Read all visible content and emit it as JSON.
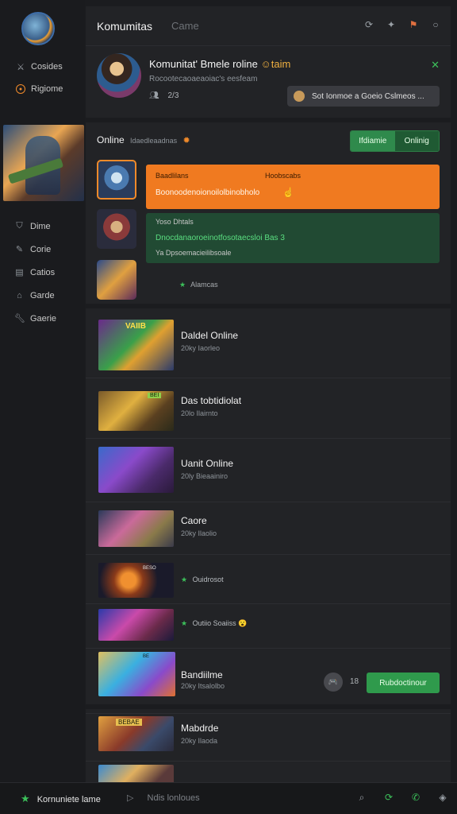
{
  "sidebar": {
    "nav": [
      {
        "label": "Cosides",
        "icon": "swords-icon"
      },
      {
        "label": "Rigiome",
        "icon": "target-icon"
      }
    ],
    "menu": [
      {
        "label": "Dime",
        "icon": "shield-icon"
      },
      {
        "label": "Corie",
        "icon": "edit-icon"
      },
      {
        "label": "Catios",
        "icon": "card-icon"
      },
      {
        "label": "Garde",
        "icon": "house-icon"
      },
      {
        "label": "Gaerie",
        "icon": "wrench-icon"
      }
    ]
  },
  "header": {
    "title": "Komumitas",
    "subtitle": "Came"
  },
  "profile": {
    "name": "Komunitat' Bmele roline",
    "name_suffix": "☺taim",
    "subtitle": "Rocootecaoaeaoiac's eesfeam",
    "member_count": "2/3",
    "action_label": "Sot Ionmoe a Goeio Cslmeos ..."
  },
  "online": {
    "title": "Online",
    "subtitle": "Idaedleaadnas",
    "toggle": [
      "Ifdiamie",
      "Onlinig"
    ],
    "messages": {
      "orange": {
        "from": "Baadlilans",
        "tag": "Hoobscabs",
        "text": "Boonoodenoionoilolbinobholo"
      },
      "green": {
        "from": "Yoso Dhtals",
        "text": "Dnocdanaoroeinotfosotaecsloi Bas 3",
        "meta": "Ya Dpsoemacieilibsoale"
      },
      "status": "Alamcas"
    }
  },
  "games": [
    {
      "title": "Daldel Online",
      "sub": "20ky Iaorleo",
      "thumb_text": "VAIIB"
    },
    {
      "title": "Das tobtidiolat",
      "sub": "20lo Ilairnto",
      "thumb_text": "BEI"
    },
    {
      "title": "Uanit Online",
      "sub": "20ly Bieaainiro",
      "thumb_text": ""
    },
    {
      "title": "Caore",
      "sub": "20ky Ilaolio",
      "thumb_text": ""
    },
    {
      "status": "Ouidrosot",
      "thumb_text": "BESO"
    },
    {
      "status": "Outiio Soaiiss",
      "emoji": "😮",
      "thumb_text": ""
    },
    {
      "title": "Bandiilme",
      "sub": "20ky Itsalolbo",
      "count": "18",
      "button": "Rubdoctinour",
      "icon": "🎮",
      "thumb_text": "BE"
    },
    {
      "title": "Mabdrde",
      "sub": "20ky Ilaoda",
      "thumb_text": "BEBAE"
    }
  ],
  "bottom": {
    "left": "Kornuniete lame",
    "mid": "Ndis lonloues"
  },
  "colors": {
    "accent_orange": "#f07a20",
    "accent_green": "#2f9a4c",
    "background": "#1b1c1f"
  }
}
